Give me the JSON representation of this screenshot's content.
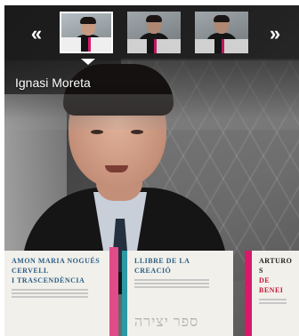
{
  "carousel": {
    "prev_icon": "double-chevron-left-icon",
    "next_icon": "double-chevron-right-icon",
    "prev_glyph": "«",
    "next_glyph": "»",
    "thumbnails": 3,
    "selected_index": 0
  },
  "caption": {
    "name": "Ignasi Moreta"
  },
  "books": [
    {
      "title": "AMON MARIA NOGUÉS",
      "subtitle": "CERVELL",
      "line3": "I TRASCENDÈNCIA"
    },
    {
      "title": "LLIBRE DE LA CREACIÓ",
      "hebrew": "ספר יצירה"
    },
    {
      "title": "ARTURO S",
      "subtitle": "DE BENEI"
    }
  ],
  "colors": {
    "bar": "#141414",
    "accent_pink": "#d8196a",
    "accent_teal": "#2b9aa5",
    "text": "#ffffff"
  }
}
